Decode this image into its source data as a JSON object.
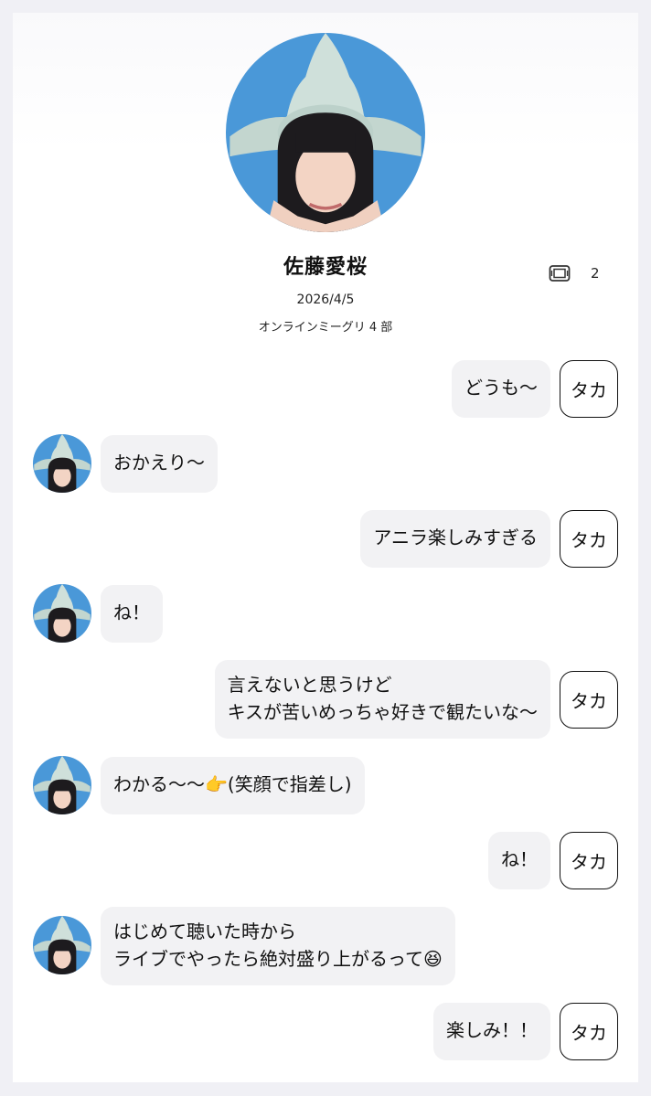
{
  "profile": {
    "name": "佐藤愛桜",
    "date": "2026/4/5",
    "event": "オンラインミーグリ 4 部",
    "ticket_icon": "ticket-icon",
    "ticket_count": "2"
  },
  "chip_label": "タカ",
  "messages": [
    {
      "from": "user",
      "text": "どうも〜"
    },
    {
      "from": "idol",
      "text": "おかえり〜"
    },
    {
      "from": "user",
      "text": "アニラ楽しみすぎる"
    },
    {
      "from": "idol",
      "text": "ね！"
    },
    {
      "from": "user",
      "text": "言えないと思うけど\nキスが苦いめっちゃ好きで観たいな〜"
    },
    {
      "from": "idol",
      "text": "わかる〜〜👉(笑顔で指差し)"
    },
    {
      "from": "user",
      "text": "ね！"
    },
    {
      "from": "idol",
      "text": "はじめて聴いた時から\nライブでやったら絶対盛り上がるって😆"
    },
    {
      "from": "user",
      "text": "楽しみ！！"
    }
  ],
  "colors": {
    "page_bg": "#f0f0f5",
    "bubble_bg": "#f2f2f4",
    "avatar_sky": "#4a98d8"
  }
}
